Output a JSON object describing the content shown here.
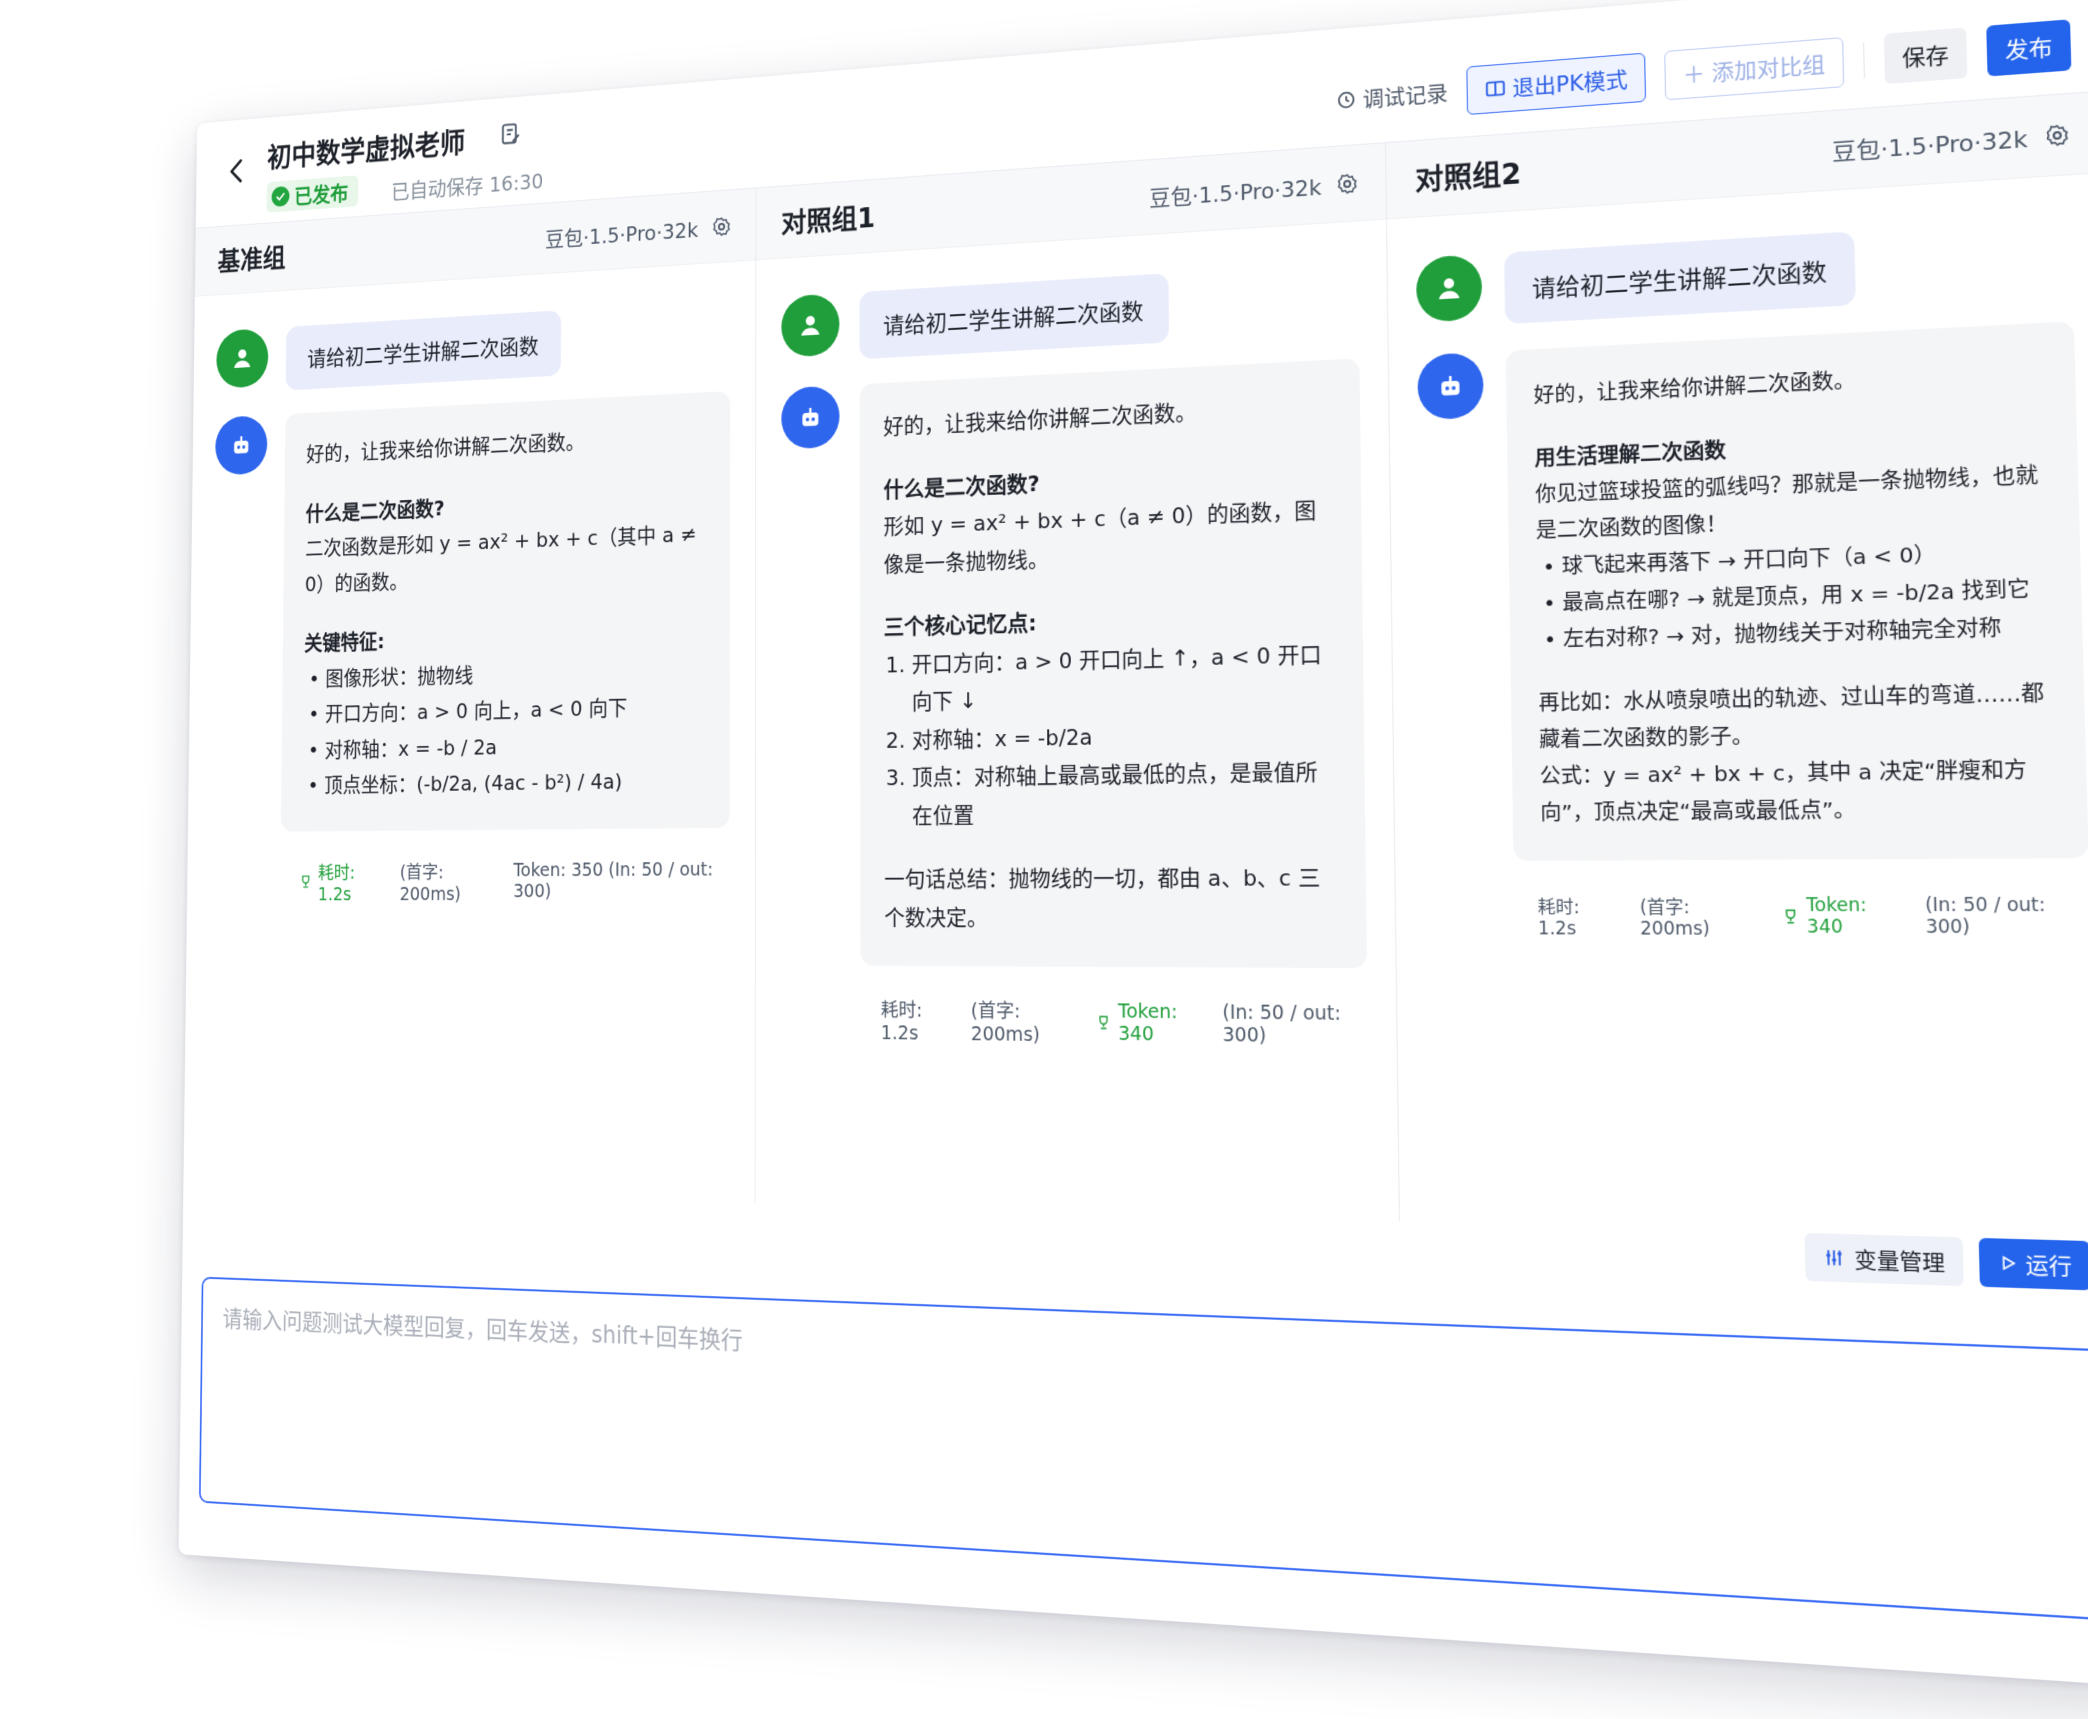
{
  "header": {
    "title": "初中数学虚拟老师",
    "status": "已发布",
    "autosave": "已自动保存 16:30",
    "debug_log": "调试记录",
    "exit_pk": "退出PK模式",
    "add_group": "添加对比组",
    "save": "保存",
    "publish": "发布"
  },
  "columns": [
    {
      "title": "基准组",
      "model": "豆包·1.5·Pro·32k",
      "question": "请给初二学生讲解二次函数",
      "answer": {
        "intro": "好的，让我来给你讲解二次函数。",
        "s1_title": "什么是二次函数?",
        "s1_body": "二次函数是形如 y = ax² + bx + c（其中 a ≠ 0）的函数。",
        "s2_title": "关键特征:",
        "bullets": [
          "图像形状：抛物线",
          "开口方向：a > 0 向上，a < 0 向下",
          "对称轴：x = -b / 2a",
          "顶点坐标：(-b/2a, (4ac - b²) / 4a)"
        ]
      },
      "meta_time": "耗时: 1.2s",
      "meta_first": "(首字: 200ms)",
      "meta_token": "Token: 350 (In: 50 / out: 300)"
    },
    {
      "title": "对照组1",
      "model": "豆包·1.5·Pro·32k",
      "question": "请给初二学生讲解二次函数",
      "answer": {
        "intro": "好的，让我来给你讲解二次函数。",
        "s1_title": "什么是二次函数?",
        "s1_body": "形如 y = ax² + bx + c（a ≠ 0）的函数，图像是一条抛物线。",
        "s2_title": "三个核心记忆点:",
        "items": [
          "开口方向：a > 0 开口向上 ↑，a < 0 开口向下 ↓",
          "对称轴：x = -b/2a",
          "顶点：对称轴上最高或最低的点，是最值所在位置"
        ],
        "summary": "一句话总结：抛物线的一切，都由 a、b、c 三个数决定。"
      },
      "meta_time": "耗时: 1.2s",
      "meta_first": "(首字: 200ms)",
      "meta_token": "Token: 340",
      "meta_io": "(In: 50 / out: 300)"
    },
    {
      "title": "对照组2",
      "model": "豆包·1.5·Pro·32k",
      "question": "请给初二学生讲解二次函数",
      "answer": {
        "intro": "好的，让我来给你讲解二次函数。",
        "s1_title": "用生活理解二次函数",
        "s1_body": "你见过篮球投篮的弧线吗？那就是一条抛物线，也就是二次函数的图像！",
        "bullets": [
          "球飞起来再落下 → 开口向下（a < 0）",
          "最高点在哪? → 就是顶点，用 x = -b/2a 找到它",
          "左右对称? → 对，抛物线关于对称轴完全对称"
        ],
        "p2": "再比如：水从喷泉喷出的轨迹、过山车的弯道……都藏着二次函数的影子。",
        "p3": "公式：y = ax² + bx + c，其中 a 决定“胖瘦和方向”，顶点决定“最高或最低点”。"
      },
      "meta_time": "耗时: 1.2s",
      "meta_first": "(首字: 200ms)",
      "meta_token": "Token: 340",
      "meta_io": "(In: 50 / out: 300)"
    }
  ],
  "input": {
    "variables": "变量管理",
    "run": "运行",
    "placeholder": "请输入问题测试大模型回复，回车发送，shift+回车换行"
  }
}
